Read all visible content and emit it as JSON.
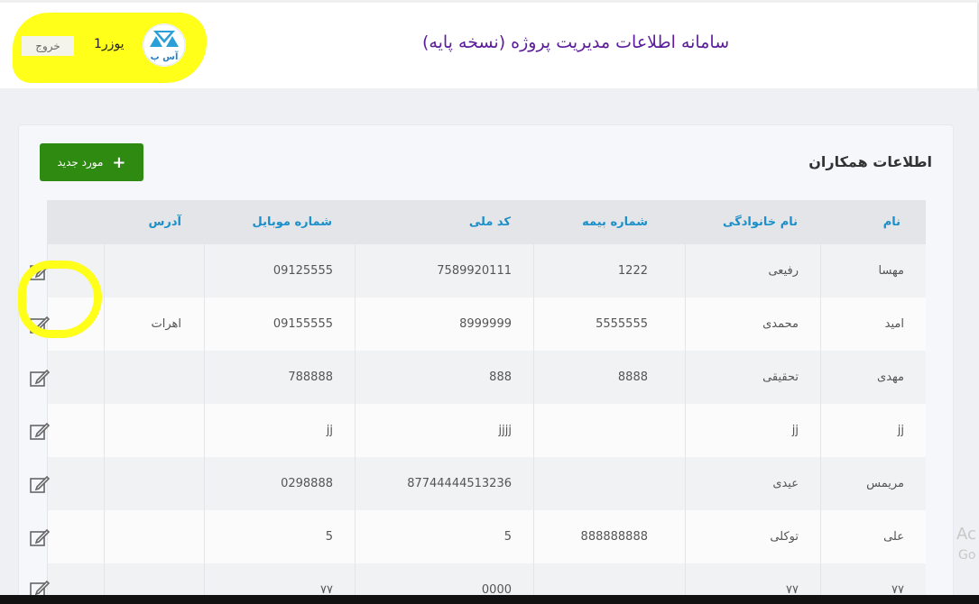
{
  "header": {
    "app_title": "سامانه اطلاعات مدیریت پروژه (نسخه پایه)",
    "username": "یوزر1",
    "logout_label": "خروج"
  },
  "section": {
    "title": "اطلاعات همکاران",
    "add_button_label": "مورد جدید"
  },
  "table": {
    "columns": [
      "نام",
      "نام خانوادگی",
      "شماره بیمه",
      "کد ملی",
      "شماره موبایل",
      "آدرس"
    ],
    "rows": [
      {
        "first_name": "مهسا",
        "last_name": "رفیعی",
        "insurance": "1222",
        "national_code": "7589920111",
        "mobile": "09125555",
        "address": ""
      },
      {
        "first_name": "امید",
        "last_name": "محمدی",
        "insurance": "5555555",
        "national_code": "8999999",
        "mobile": "09155555",
        "address": "اهرات"
      },
      {
        "first_name": "مهدی",
        "last_name": "تحقیقی",
        "insurance": "8888",
        "national_code": "888",
        "mobile": "788888",
        "address": ""
      },
      {
        "first_name": "jj",
        "last_name": "jj",
        "insurance": "",
        "national_code": "jjjj",
        "mobile": "jj",
        "address": ""
      },
      {
        "first_name": "مریمس",
        "last_name": "عیدی",
        "insurance": "",
        "national_code": "87744444513236",
        "mobile": "0298888",
        "address": ""
      },
      {
        "first_name": "علی",
        "last_name": "توکلی",
        "insurance": "888888888",
        "national_code": "5",
        "mobile": "5",
        "address": ""
      },
      {
        "first_name": "۷۷",
        "last_name": "۷۷",
        "insurance": "",
        "national_code": "0000",
        "mobile": "۷۷",
        "address": ""
      }
    ]
  },
  "overlay": {
    "watermark_line1": "Ac",
    "watermark_line2": "Go"
  },
  "colors": {
    "title_purple": "#5c1c9c",
    "header_blue": "#1a8fc9",
    "add_green": "#2e8a11",
    "highlight_yellow": "#ffff1a"
  }
}
